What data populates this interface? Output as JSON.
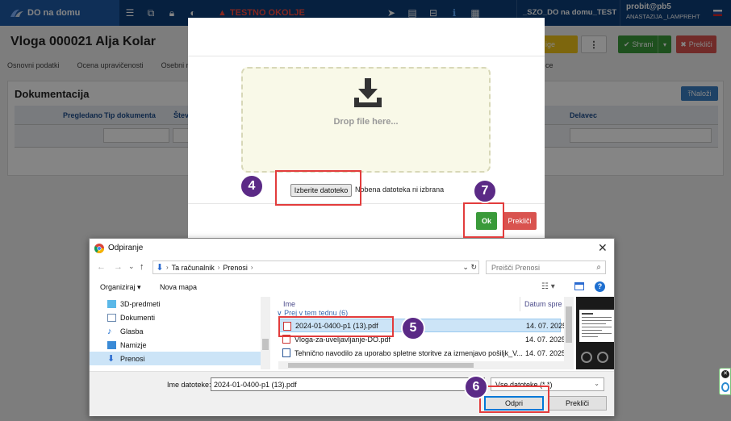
{
  "navbar": {
    "brand": "DO na domu",
    "env_warning": "TESTNO OKOLJE",
    "env_name": "_SZO_DO na domu_TEST",
    "user": "probit@pb5",
    "user_full": "ANASTAZIJA _LAMPREHT",
    "icons": [
      "list-icon",
      "external-link-icon",
      "lock-icon",
      "contrast-icon",
      "send-icon",
      "card-icon",
      "screen-icon",
      "info-icon",
      "document-icon"
    ]
  },
  "page": {
    "title": "Vloga 000021 Alja Kolar",
    "tabs": [
      "Osnovni podatki",
      "Ocena upravičenosti",
      "Osebni n"
    ],
    "tab_extra": "ce",
    "yellow_button": "ige",
    "save_button": "Shrani",
    "cancel_button": "Prekliči"
  },
  "documents": {
    "title": "Dokumentacija",
    "upload_button": "Naloži",
    "columns": [
      "Pregledano",
      "Tip dokumenta",
      "Štev",
      "Delavec"
    ]
  },
  "modal": {
    "drop_text": "Drop file here...",
    "file_button": "Izberite datoteko",
    "file_status": "Nobena datoteka ni izbrana",
    "ok_button": "Ok",
    "cancel_button": "Prekliči"
  },
  "dialog": {
    "title": "Odpiranje",
    "path": [
      "Ta računalnik",
      "Prenosi"
    ],
    "search_placeholder": "Preišči Prenosi",
    "organize": "Organiziraj",
    "new_folder": "Nova mapa",
    "tree": [
      "3D-predmeti",
      "Dokumenti",
      "Glasba",
      "Namizje",
      "Prenosi"
    ],
    "column_name": "Ime",
    "column_date": "Datum spre",
    "group": "Prej v tem tednu (6)",
    "files": [
      {
        "name": "2024-01-0400-p1 (13).pdf",
        "date": "14. 07. 2025",
        "type": "pdf"
      },
      {
        "name": "Vloga-za-uveljavljanje-DO.pdf",
        "date": "14. 07. 2025",
        "type": "pdf"
      },
      {
        "name": "Tehnično navodilo za uporabo spletne storitve za izmenjavo pošiljk_V...",
        "date": "14. 07. 2025",
        "type": "word"
      }
    ],
    "filename_label": "Ime datoteke:",
    "filename_value": "2024-01-0400-p1 (13).pdf",
    "filetype": "Vse datoteke (*.*)",
    "open_button": "Odpri",
    "cancel_button": "Prekliči"
  },
  "callouts": [
    "4",
    "5",
    "6",
    "7"
  ],
  "colors": {
    "navbar": "#0d3f7a",
    "callout": "#5b2a86",
    "highlight": "#e23c3c",
    "ok_green": "#3a9a3a",
    "cancel_red": "#d9534f"
  }
}
